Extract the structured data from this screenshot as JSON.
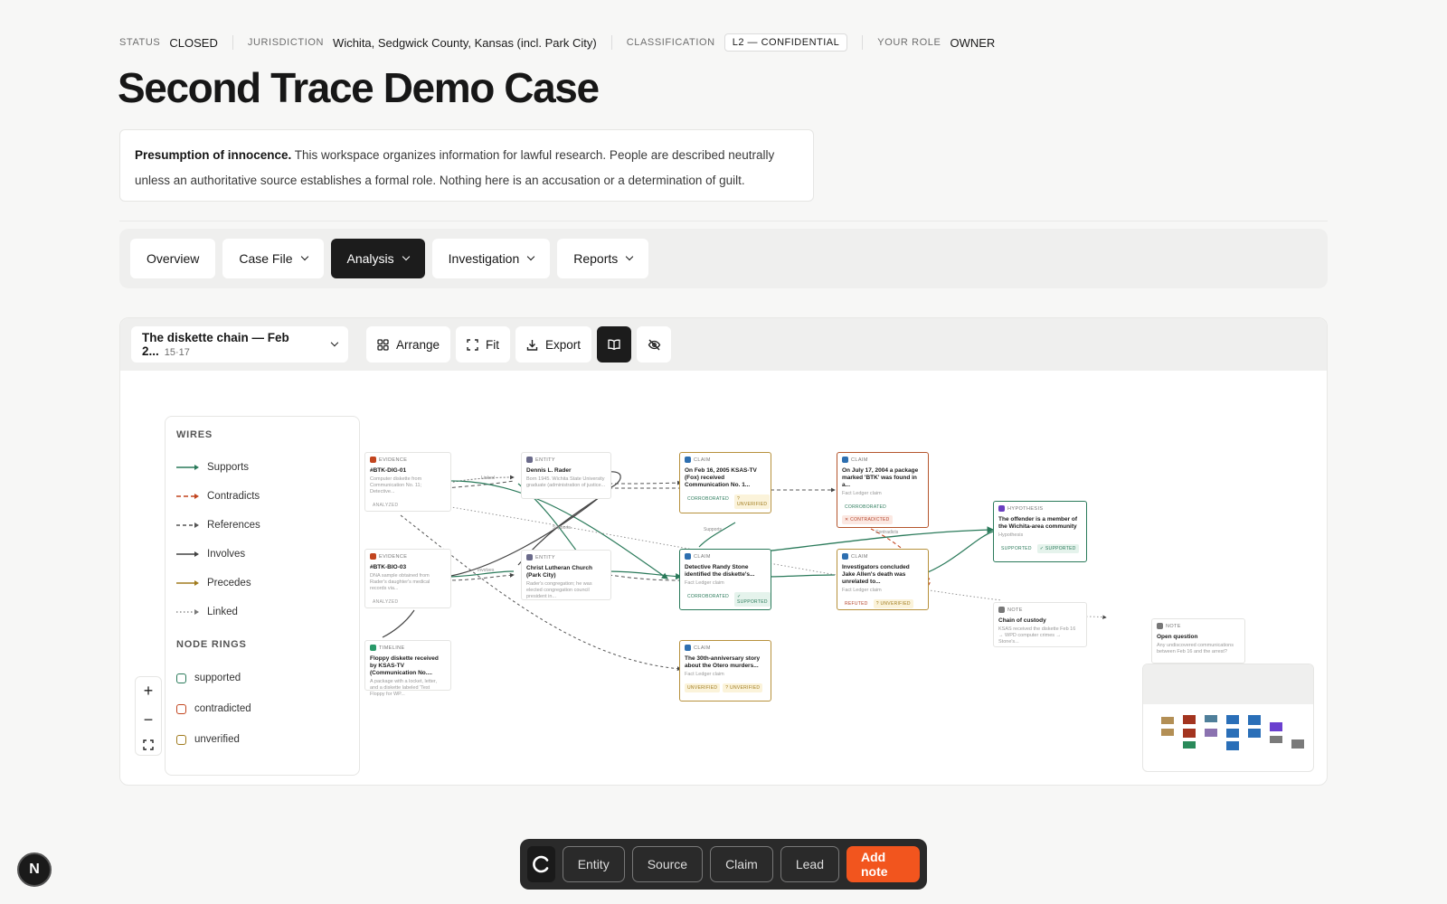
{
  "meta": {
    "status_label": "STATUS",
    "status": "CLOSED",
    "jurisdiction_label": "JURISDICTION",
    "jurisdiction": "Wichita, Sedgwick County, Kansas (incl. Park City)",
    "classification_label": "CLASSIFICATION",
    "classification": "L2 — CONFIDENTIAL",
    "role_label": "YOUR ROLE",
    "role": "OWNER"
  },
  "title": "Second Trace Demo Case",
  "notice": {
    "lead": "Presumption of innocence.",
    "body": " This workspace organizes information for lawful research. People are described neutrally unless an authoritative source establishes a formal role. Nothing here is an accusation or a determination of guilt."
  },
  "nav": {
    "overview": "Overview",
    "case_file": "Case File",
    "analysis": "Analysis",
    "investigation": "Investigation",
    "reports": "Reports"
  },
  "toolbar": {
    "view_name": "The diskette chain — Feb 2...",
    "view_count": "15·17",
    "arrange": "Arrange",
    "fit": "Fit",
    "export": "Export"
  },
  "legend": {
    "wires_title": "WIRES",
    "wires": [
      "Supports",
      "Contradicts",
      "References",
      "Involves",
      "Precedes",
      "Linked"
    ],
    "rings_title": "NODE RINGS",
    "rings": [
      "supported",
      "contradicted",
      "unverified"
    ],
    "colors": {
      "supports": "#2a7a5a",
      "contradicts": "#c2451f",
      "references": "#555555",
      "involves": "#444444",
      "precedes": "#a07b1e",
      "linked": "#777777"
    }
  },
  "nodes": {
    "ev1": {
      "kind": "EVIDENCE",
      "title": "#BTK-DIG-01",
      "sub": "Computer diskette from Communication No. 11; Detective...",
      "tag1": "ANALYZED"
    },
    "ev2": {
      "kind": "EVIDENCE",
      "title": "#BTK-BIO-03",
      "sub": "DNA sample obtained from Rader's daughter's medical records via...",
      "tag1": "ANALYZED"
    },
    "tl1": {
      "kind": "TIMELINE",
      "title": "Floppy diskette received by KSAS-TV (Communication No....",
      "sub": "A package with a locket, letter, and a diskette labeled 'Test Floppy for WP..."
    },
    "en1": {
      "kind": "ENTITY",
      "title": "Dennis L. Rader",
      "sub": "Born 1945. Wichita State University graduate (administration of justice..."
    },
    "en2": {
      "kind": "ENTITY",
      "title": "Christ Lutheran Church (Park City)",
      "sub": "Rader's congregation; he was elected congregation council president in..."
    },
    "cl1": {
      "kind": "CLAIM",
      "title": "On Feb 16, 2005 KSAS-TV (Fox) received Communication No. 1...",
      "sub": "Fact Ledger claim",
      "tag1": "CORROBORATED",
      "tag2": "? UNVERIFIED"
    },
    "cl2": {
      "kind": "CLAIM",
      "title": "Detective Randy Stone identified the diskette's...",
      "sub": "Fact Ledger claim",
      "tag1": "CORROBORATED",
      "tag2": "✓ SUPPORTED"
    },
    "cl3": {
      "kind": "CLAIM",
      "title": "The 30th-anniversary story about the Otero murders...",
      "sub": "Fact Ledger claim",
      "tag1": "UNVERIFIED",
      "tag2": "? UNVERIFIED"
    },
    "cl4": {
      "kind": "CLAIM",
      "title": "On July 17, 2004 a package marked 'BTK' was found in a...",
      "sub": "Fact Ledger claim",
      "tag1": "CORROBORATED",
      "tag2": "✕ CONTRADICTED"
    },
    "cl5": {
      "kind": "CLAIM",
      "title": "Investigators concluded Jake Allen's death was unrelated to...",
      "sub": "Fact Ledger claim",
      "tag1": "REFUTED",
      "tag2": "? UNVERIFIED"
    },
    "hy1": {
      "kind": "HYPOTHESIS",
      "title": "The offender is a member of the Wichita-area community",
      "sub": "Hypothesis",
      "tag1": "SUPPORTED",
      "tag2": "✓ SUPPORTED"
    },
    "no1": {
      "kind": "NOTE",
      "title": "Chain of custody",
      "sub": "KSAS received the diskette Feb 16 → WPD computer crimes → Stone's..."
    },
    "no2": {
      "kind": "NOTE",
      "title": "Open question",
      "sub": "Any undiscovered communications between Feb 16 and the arrest?"
    }
  },
  "edge_labels": {
    "linked": "Linked",
    "supports": "Supports",
    "contradicts": "Contradicts",
    "involves": "Involves"
  },
  "dock": {
    "entity": "Entity",
    "source": "Source",
    "claim": "Claim",
    "lead": "Lead",
    "add_note": "Add note"
  },
  "fab": "N"
}
